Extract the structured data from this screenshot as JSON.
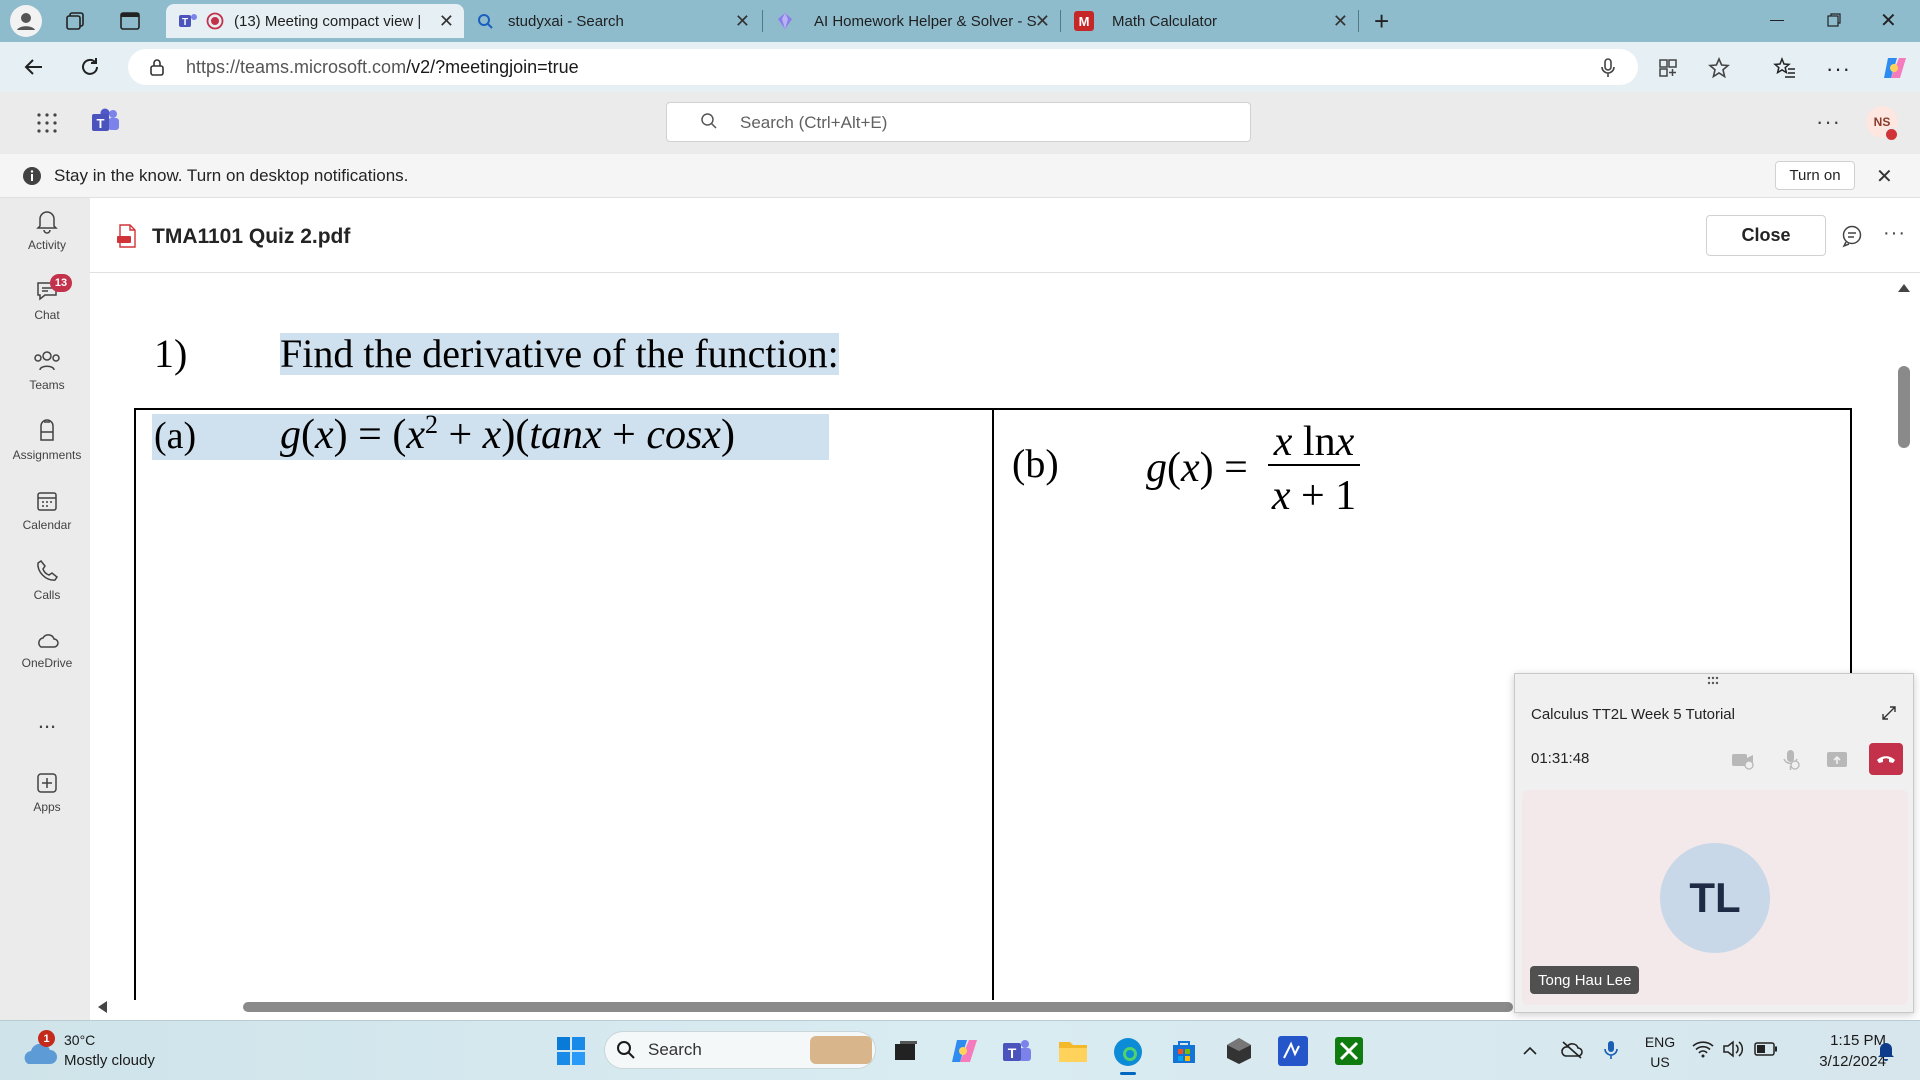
{
  "browser": {
    "tabs": [
      {
        "title": "(13) Meeting compact view |",
        "active": true
      },
      {
        "title": "studyxai - Search",
        "active": false
      },
      {
        "title": "AI Homework Helper & Solver - S",
        "active": false
      },
      {
        "title": "Math Calculator",
        "active": false
      }
    ],
    "url_host": "https://teams.microsoft.com",
    "url_path": "/v2/?meetingjoin=true"
  },
  "teams": {
    "search_placeholder": "Search (Ctrl+Alt+E)",
    "user_initials": "NS",
    "banner_text": "Stay in the know. Turn on desktop notifications.",
    "banner_button": "Turn on",
    "rail": {
      "activity": "Activity",
      "chat": "Chat",
      "chat_badge": "13",
      "teams": "Teams",
      "assignments": "Assignments",
      "calendar": "Calendar",
      "calls": "Calls",
      "onedrive": "OneDrive",
      "more": "...",
      "apps": "Apps"
    }
  },
  "document": {
    "filename": "TMA1101 Quiz 2.pdf",
    "close_label": "Close",
    "q_number": "1)",
    "q_text": "Find the derivative of the function:",
    "part_a_label": "(a)",
    "part_b_label": "(b)"
  },
  "meeting": {
    "title": "Calculus TT2L Week 5 Tutorial",
    "timer": "01:31:48",
    "participant_initials": "TL",
    "participant_name": "Tong Hau Lee"
  },
  "taskbar": {
    "weather_badge": "1",
    "temperature": "30°C",
    "condition": "Mostly cloudy",
    "search_label": "Search",
    "lang_top": "ENG",
    "lang_bottom": "US",
    "time": "1:15 PM",
    "date": "3/12/2024"
  }
}
